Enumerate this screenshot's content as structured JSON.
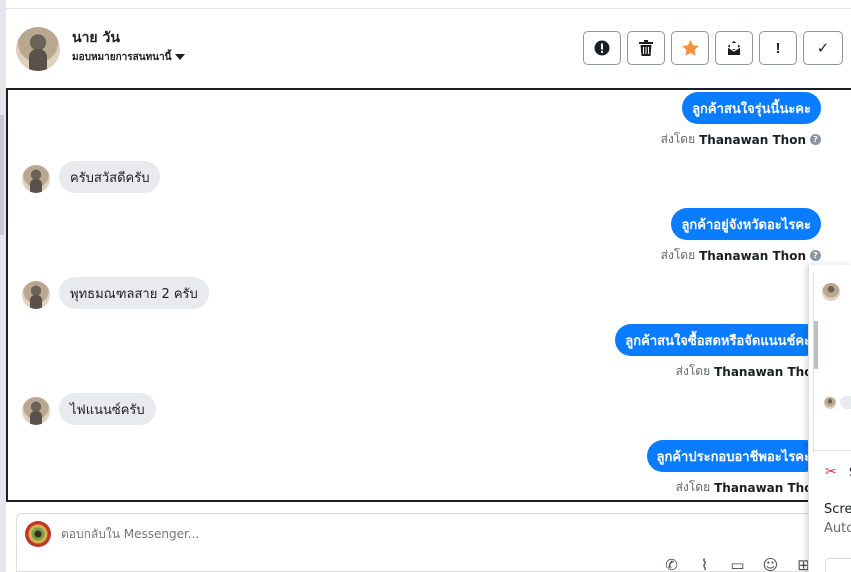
{
  "header": {
    "contact_name": "นาย วัน",
    "assign_label": "มอบหมายการสนทนานี้",
    "actions": [
      {
        "name": "spam-button",
        "icon": "exclamation-circle-icon",
        "glyph": "⬤"
      },
      {
        "name": "delete-button",
        "icon": "trash-icon",
        "glyph": "🗑"
      },
      {
        "name": "star-button",
        "icon": "star-icon",
        "glyph": "★",
        "color": "#f7923a"
      },
      {
        "name": "mark-unread-button",
        "icon": "envelope-icon",
        "glyph": "✉"
      },
      {
        "name": "follow-up-button",
        "icon": "exclamation-icon",
        "glyph": "!"
      },
      {
        "name": "done-button",
        "icon": "check-icon",
        "glyph": "✓"
      }
    ]
  },
  "messages": {
    "m1": "ลูกค้าสนใจรุ่นนี้นะคะ",
    "m2": "ครับสวัสดีครับ",
    "m3": "ลูกค้าอยู่จังหวัดอะไรคะ",
    "m4": "พุทธมณฑลสาย 2 ครับ",
    "m5": "ลูกค้าสนใจซื้อสดหรือจัดแนนช์คะ",
    "m6": "ไฟแนนซ์ครับ",
    "m7": "ลูกค้าประกอบอาชีพอะไรคะ"
  },
  "sent_by": {
    "prefix": "ส่งโดย",
    "agent": "Thanawan Thon"
  },
  "composer": {
    "placeholder": "ตอบกลับใน Messenger..."
  },
  "tools": [
    {
      "name": "add-call-icon",
      "glyph": "✆"
    },
    {
      "name": "attach-icon",
      "glyph": "📎"
    },
    {
      "name": "saved-reply-icon",
      "glyph": "💬"
    },
    {
      "name": "emoji-icon",
      "glyph": "☺"
    },
    {
      "name": "more-icon",
      "glyph": "⊞"
    }
  ],
  "overlay": {
    "title_fragment": "S",
    "line1": "Scre",
    "line2": "Auto"
  },
  "colors": {
    "accent": "#0a7cff",
    "incoming_bubble": "#e9eaed",
    "star": "#f7923a"
  }
}
